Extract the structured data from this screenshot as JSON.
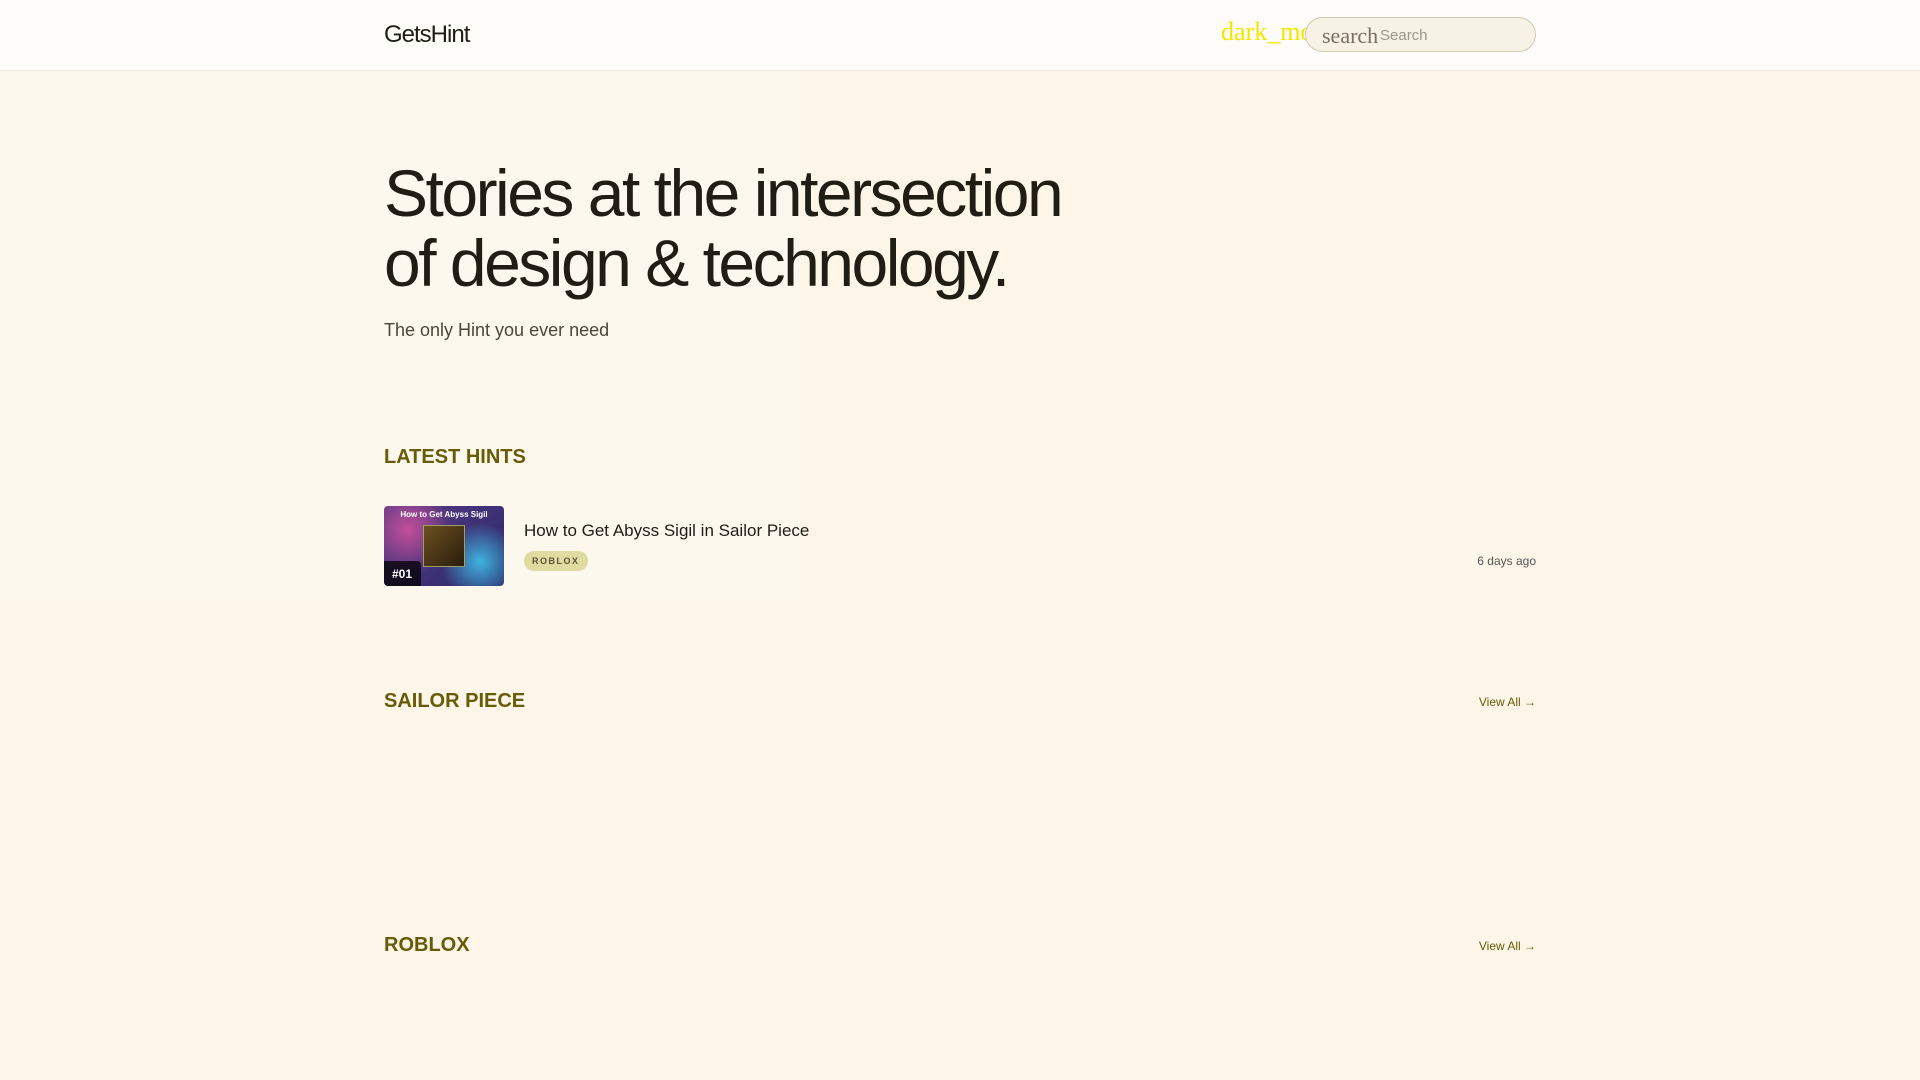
{
  "header": {
    "logo": "GetsHint",
    "dark_mode_icon": "dark_mode",
    "search_icon": "search",
    "search_placeholder": "Search"
  },
  "hero": {
    "title": "Stories at the intersection of design & technology.",
    "subtitle": "The only Hint you ever need"
  },
  "latest": {
    "heading": "LATEST HINTS",
    "posts": [
      {
        "rank": "#01",
        "title": "How to Get Abyss Sigil in Sailor Piece",
        "tag": "ROBLOX",
        "time": "6 days ago",
        "thumb_title": "How to Get Abyss Sigil"
      }
    ]
  },
  "sections": [
    {
      "heading": "SAILOR PIECE",
      "view_all": "View All →"
    },
    {
      "heading": "ROBLOX",
      "view_all": "View All →"
    }
  ]
}
